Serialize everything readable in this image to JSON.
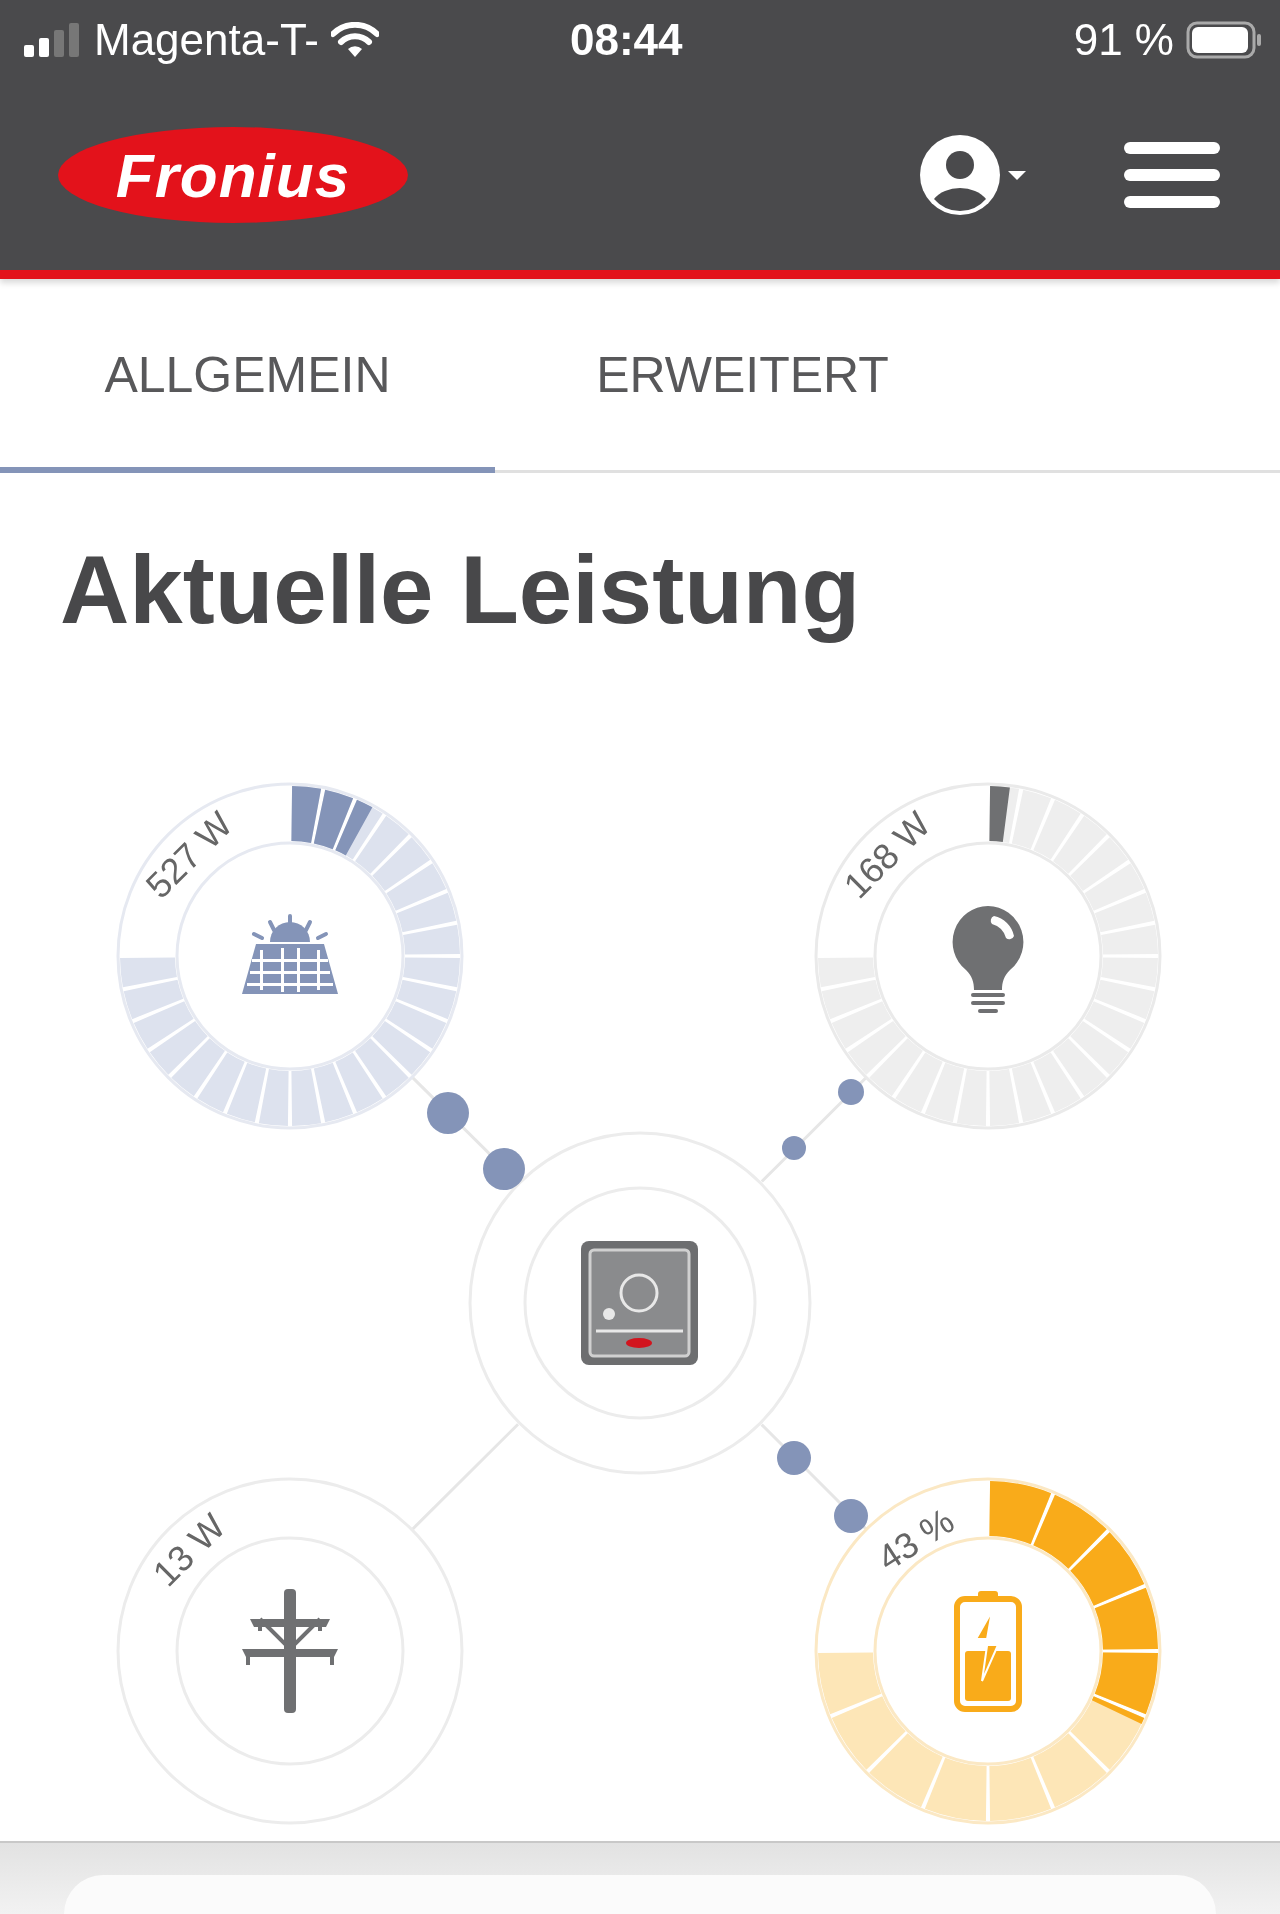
{
  "status_bar": {
    "carrier": "Magenta-T-",
    "time": "08:44",
    "battery": "91 %"
  },
  "header": {
    "logo": "Fronius"
  },
  "tabs": [
    {
      "label": "ALLGEMEIN",
      "selected": true
    },
    {
      "label": "ERWEITERT",
      "selected": false
    }
  ],
  "title": "Aktuelle Leistung",
  "gauges": [
    {
      "kind": "solar",
      "reading": "527 W"
    },
    {
      "kind": "load",
      "reading": "168 W"
    },
    {
      "kind": "grid",
      "reading": "13 W"
    },
    {
      "kind": "battery",
      "reading": "43 %"
    }
  ]
}
